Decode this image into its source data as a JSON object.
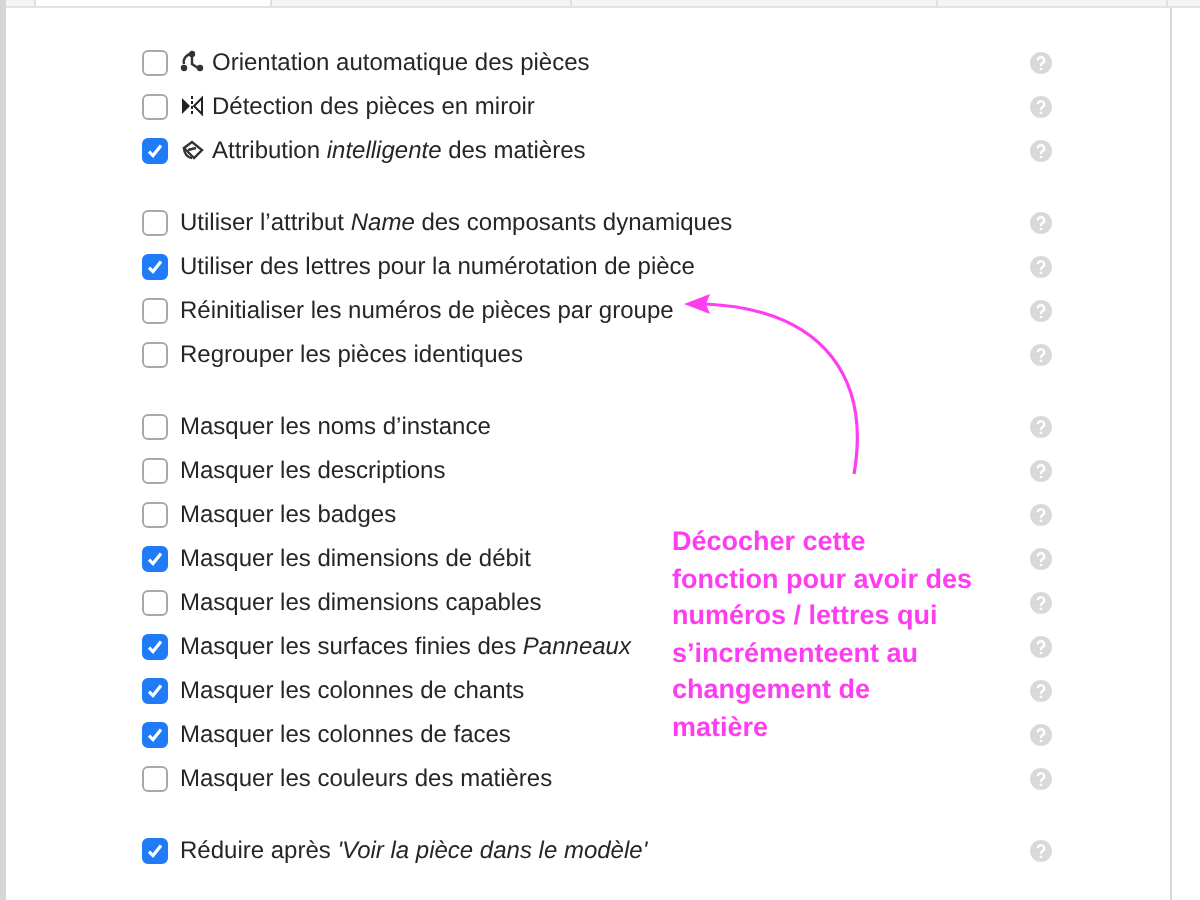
{
  "sections": [
    {
      "items": [
        {
          "kind": "orientation",
          "label": "Orientation automatique des pièces",
          "checked": false
        },
        {
          "kind": "mirror",
          "label": "Détection des pièces en miroir",
          "checked": false
        },
        {
          "kind": "material",
          "label": "Attribution *intelligente* des matières",
          "checked": true
        }
      ]
    },
    {
      "items": [
        {
          "kind": "plain",
          "label": "Utiliser l’attribut *Name* des composants dynamiques",
          "checked": false
        },
        {
          "kind": "plain",
          "label": "Utiliser des lettres pour la numérotation de pièce",
          "checked": true
        },
        {
          "kind": "plain",
          "label": "Réinitialiser les numéros de pièces par groupe",
          "checked": false
        },
        {
          "kind": "plain",
          "label": "Regrouper les pièces identiques",
          "checked": false
        }
      ]
    },
    {
      "items": [
        {
          "kind": "plain",
          "label": "Masquer les noms d’instance",
          "checked": false
        },
        {
          "kind": "plain",
          "label": "Masquer les descriptions",
          "checked": false
        },
        {
          "kind": "plain",
          "label": "Masquer les badges",
          "checked": false
        },
        {
          "kind": "plain",
          "label": "Masquer les dimensions de débit",
          "checked": true
        },
        {
          "kind": "plain",
          "label": "Masquer les dimensions capables",
          "checked": false
        },
        {
          "kind": "plain",
          "label": "Masquer les surfaces finies des *Panneaux*",
          "checked": true
        },
        {
          "kind": "plain",
          "label": "Masquer les colonnes de chants",
          "checked": true
        },
        {
          "kind": "plain",
          "label": "Masquer les colonnes de faces",
          "checked": true
        },
        {
          "kind": "plain",
          "label": "Masquer les couleurs des matières",
          "checked": false
        }
      ]
    },
    {
      "items": [
        {
          "kind": "plain",
          "label": "Réduire après *'Voir la pièce dans le modèle'*",
          "checked": true
        }
      ]
    }
  ],
  "annotation": {
    "text": "Décocher cette fonction pour avoir des numéros / lettres qui s’incrémenteent au changement de matière"
  }
}
